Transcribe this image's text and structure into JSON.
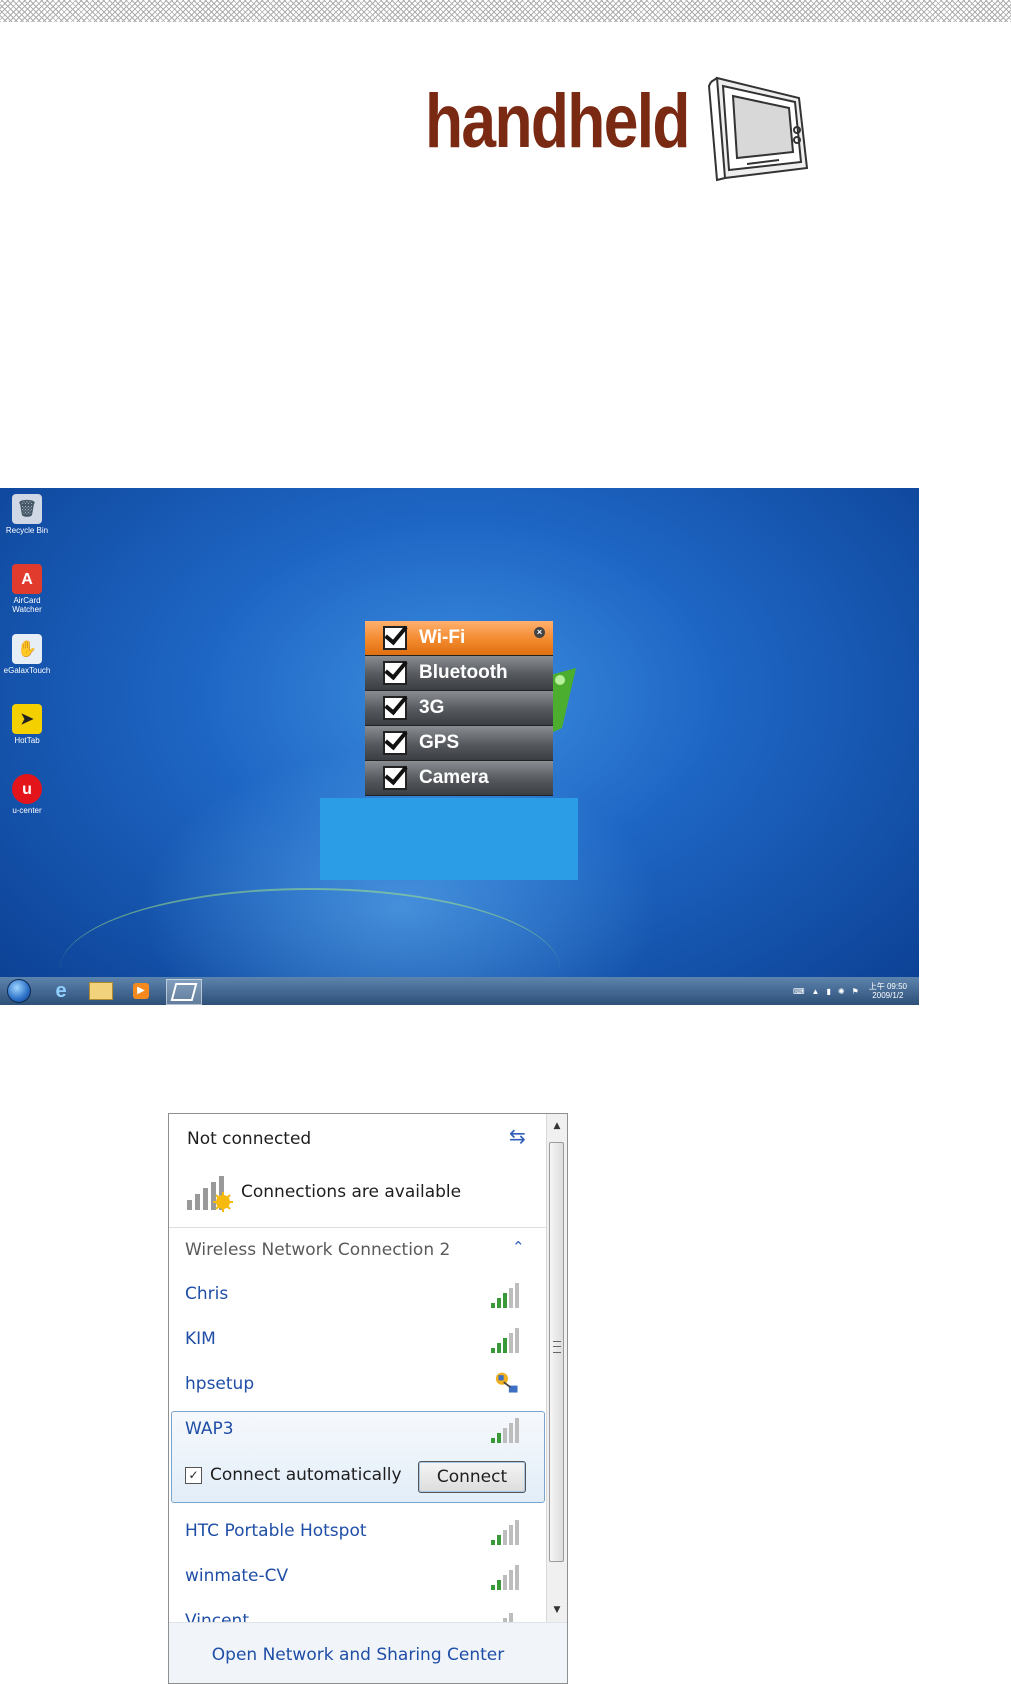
{
  "logo": {
    "text": "handheld"
  },
  "desktop": {
    "icons": [
      {
        "label": "Recycle Bin",
        "icon": "recycle-bin-icon"
      },
      {
        "label": "AirCard Watcher",
        "icon": "aircard-icon"
      },
      {
        "label": "eGalaxTouch",
        "icon": "egalax-icon"
      },
      {
        "label": "HotTab",
        "icon": "hottab-icon"
      },
      {
        "label": "u-center",
        "icon": "ucenter-icon"
      }
    ],
    "menu": {
      "items": [
        {
          "label": "Wi-Fi",
          "checked": true
        },
        {
          "label": "Bluetooth",
          "checked": true
        },
        {
          "label": "3G",
          "checked": true
        },
        {
          "label": "GPS",
          "checked": true
        },
        {
          "label": "Camera",
          "checked": true
        }
      ],
      "accent": "#f28a2e"
    },
    "taskbar": {
      "clock_ampm": "上午 09:50",
      "clock_date": "2009/1/2"
    }
  },
  "network": {
    "status": "Not connected",
    "availability": "Connections are available",
    "group_title": "Wireless Network Connection 2",
    "networks": [
      {
        "name": "Chris",
        "signal": 3
      },
      {
        "name": "KIM",
        "signal": 3
      },
      {
        "name": "hpsetup",
        "signal": null
      },
      {
        "name": "WAP3",
        "signal": 2
      },
      {
        "name": "HTC Portable Hotspot",
        "signal": 2
      },
      {
        "name": "winmate-CV",
        "signal": 2
      },
      {
        "name": "Vincent",
        "signal": 2
      }
    ],
    "connect_auto_label": "Connect automatically",
    "connect_auto_checked": true,
    "connect_button": "Connect",
    "footer_link": "Open Network and Sharing Center",
    "link_color": "#1f4ea7"
  }
}
